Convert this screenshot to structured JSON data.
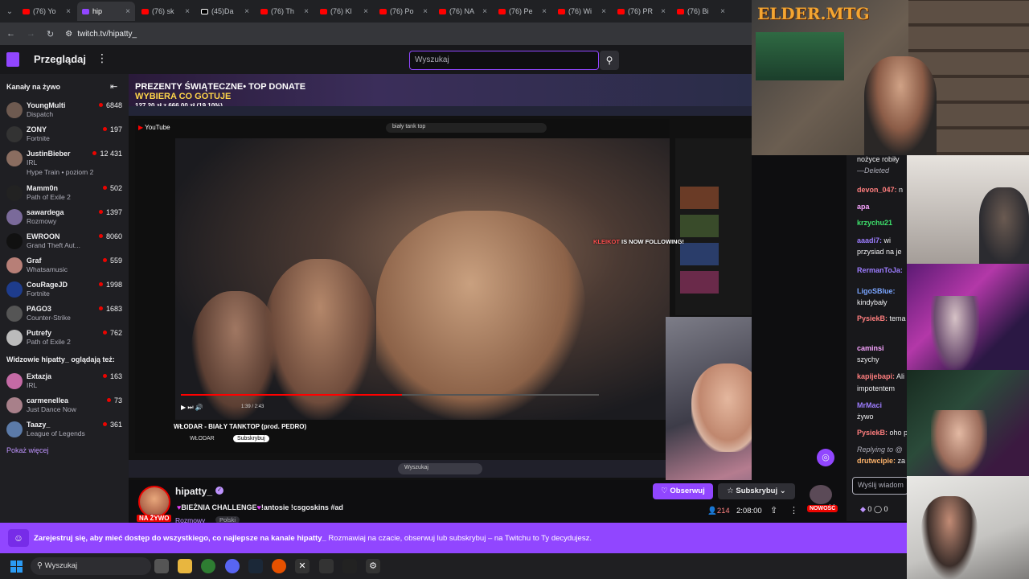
{
  "browser": {
    "tabs": [
      {
        "label": "(76) Yo",
        "fav": "yt"
      },
      {
        "label": "hip",
        "fav": "tw",
        "active": true
      },
      {
        "label": "(76) sk",
        "fav": "yt"
      },
      {
        "label": "(45)Da",
        "fav": "tt"
      },
      {
        "label": "(76) Th",
        "fav": "yt"
      },
      {
        "label": "(76) Kl",
        "fav": "yt"
      },
      {
        "label": "(76) Po",
        "fav": "yt"
      },
      {
        "label": "(76) NA",
        "fav": "yt"
      },
      {
        "label": "(76) Pe",
        "fav": "yt"
      },
      {
        "label": "(76) Wi",
        "fav": "yt"
      },
      {
        "label": "(76) PR",
        "fav": "yt"
      },
      {
        "label": "(76) Bi",
        "fav": "yt"
      }
    ],
    "url": "twitch.tv/hipatty_"
  },
  "nav": {
    "browse": "Przeglądaj",
    "search_placeholder": "Wyszukaj"
  },
  "sidebar": {
    "live_header": "Kanały na żywo",
    "channels": [
      {
        "name": "YoungMulti",
        "game": "Dispatch",
        "viewers": "6848",
        "color": "#6e5a50"
      },
      {
        "name": "ZONY",
        "game": "Fortnite",
        "viewers": "197",
        "color": "#333"
      },
      {
        "name": "JustinBieber",
        "game": "IRL",
        "viewers": "12 431",
        "color": "#8a6d60"
      },
      {
        "name": "Mamm0n",
        "game": "Path of Exile 2",
        "viewers": "502",
        "color": "#222"
      },
      {
        "name": "sawardega",
        "game": "Rozmowy",
        "viewers": "1397",
        "color": "#7a6a9a"
      },
      {
        "name": "EWROON",
        "game": "Grand Theft Aut...",
        "viewers": "8060",
        "color": "#111"
      },
      {
        "name": "Graf",
        "game": "Whatsamusic",
        "viewers": "559",
        "color": "#b77f77"
      },
      {
        "name": "CouRageJD",
        "game": "Fortnite",
        "viewers": "1998",
        "color": "#1e3c8c"
      },
      {
        "name": "PAGO3",
        "game": "Counter-Strike",
        "viewers": "1683",
        "color": "#555"
      },
      {
        "name": "Putrefy",
        "game": "Path of Exile 2",
        "viewers": "762",
        "color": "#bbb"
      }
    ],
    "hype_train": "Hype Train • poziom 2",
    "also_header": "Widzowie hipatty_ oglądają też:",
    "also": [
      {
        "name": "Extazja",
        "game": "IRL",
        "viewers": "163",
        "color": "#c46aa5"
      },
      {
        "name": "carmenellea",
        "game": "Just Dance Now",
        "viewers": "73",
        "color": "#a8808a"
      },
      {
        "name": "Taazy_",
        "game": "League of Legends",
        "viewers": "361",
        "color": "#5b7aa8"
      }
    ],
    "show_more": "Pokaż więcej"
  },
  "video": {
    "banner_line1": "PREZENTY ŚWIĄTECZNE• TOP DONATE",
    "banner_line2": "WYBIERA CO GOTUJE",
    "banner_line3": "127,20 zł z 666,00 zł (19,10%)",
    "yt_search": "biały tank top",
    "yt_title": "WŁODAR - BIAŁY TANKTOP (prod. PEDRO)",
    "yt_channel": "WŁODAR",
    "yt_subscribe": "Subskrybuj",
    "time": "1:39 / 2:43",
    "follow_user": "KLEIKOT",
    "follow_text": "IS NOW FOLLOWING!",
    "inner_search": "Wyszukaj"
  },
  "channel": {
    "name": "hipatty_",
    "title_prefix": "BIEŻNIA CHALLENGE",
    "title_suffix": "!antosie !csgoskins #ad",
    "category": "Rozmowy",
    "language": "Polski",
    "live": "NA ŻYWO",
    "follow": "Obserwuj",
    "subscribe": "Subskrybuj",
    "viewers": "214",
    "uptime": "2:08:00",
    "new_badge": "NOWOŚĆ"
  },
  "chat": {
    "messages": [
      {
        "user": "",
        "text": "nożyce robiły",
        "cls": ""
      },
      {
        "user": "",
        "text": "—Deleted",
        "cls": ""
      },
      {
        "user": "devon_047:",
        "text": "n",
        "cls": "u1"
      },
      {
        "user": "apa",
        "text": "",
        "cls": "u2"
      },
      {
        "user": "krzychu21",
        "text": "",
        "cls": "u3"
      },
      {
        "user": "aaadi7:",
        "text": "wi",
        "cls": "u4"
      },
      {
        "user": "",
        "text": "przysiad na je",
        "cls": ""
      },
      {
        "user": "RermanToJa:",
        "text": "",
        "cls": "u4"
      },
      {
        "user": "LigoSBlue:",
        "text": "",
        "cls": "u5"
      },
      {
        "user": "",
        "text": "kindybały",
        "cls": ""
      },
      {
        "user": "PysiekB:",
        "text": "tema",
        "cls": "u1"
      },
      {
        "user": "caminsi",
        "text": "",
        "cls": "u2"
      },
      {
        "user": "",
        "text": "szychy",
        "cls": ""
      },
      {
        "user": "kapijebapi:",
        "text": "Ali",
        "cls": "u1"
      },
      {
        "user": "",
        "text": "impotentem",
        "cls": ""
      },
      {
        "user": "MrMaci",
        "text": "",
        "cls": "u4"
      },
      {
        "user": "",
        "text": "żywo",
        "cls": ""
      },
      {
        "user": "PysiekB:",
        "text": "oho p",
        "cls": "u1"
      },
      {
        "user": "",
        "text": "Replying to @",
        "cls": ""
      },
      {
        "user": "drutwcipie:",
        "text": "za",
        "cls": "u6"
      }
    ],
    "input_placeholder": "Wyślij wiadom",
    "points": "0",
    "bits": "0"
  },
  "webcam": {
    "logo": "ELDER.MTG"
  },
  "signup": {
    "bold": "Zarejestruj się, aby mieć dostęp do wszystkiego, co najlepsze na kanale hipatty_",
    "text": "Rozmawiaj na czacie, obserwuj lub subskrybuj – na Twitchu to Ty decydujesz."
  },
  "taskbar": {
    "search": "Wyszukaj"
  }
}
